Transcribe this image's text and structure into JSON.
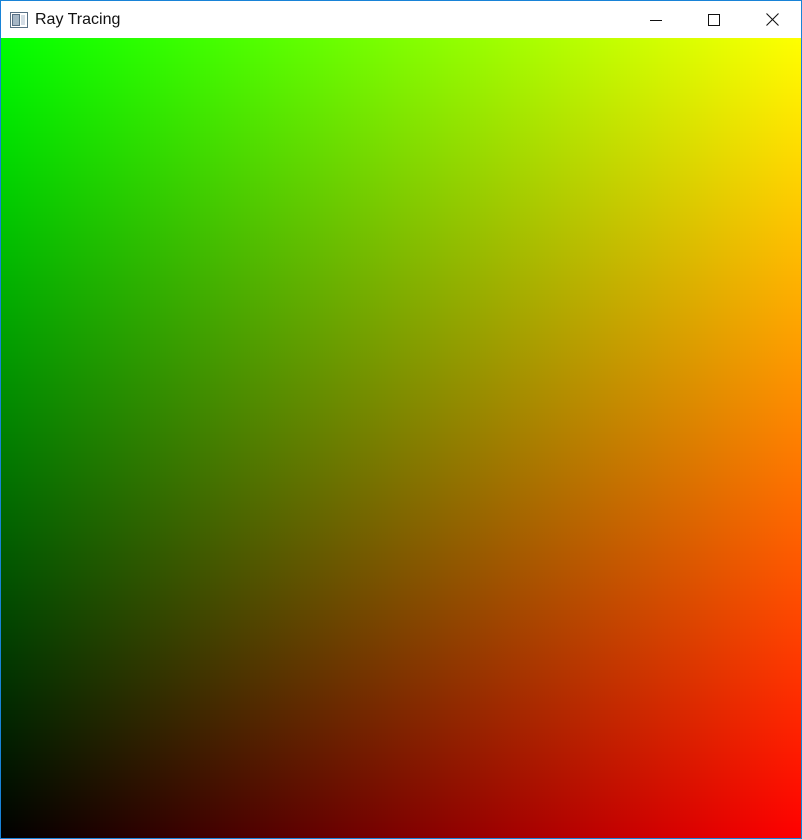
{
  "window": {
    "title": "Ray Tracing",
    "icon": "app-window-icon",
    "controls": [
      {
        "name": "minimize-button",
        "icon": "minimize-icon"
      },
      {
        "name": "maximize-button",
        "icon": "maximize-icon"
      },
      {
        "name": "close-button",
        "icon": "close-icon"
      }
    ]
  },
  "render": {
    "gradient": {
      "top_left": "#00ff00",
      "top_right": "#ffff00",
      "bottom_left": "#000000",
      "bottom_right": "#ff0000"
    }
  }
}
